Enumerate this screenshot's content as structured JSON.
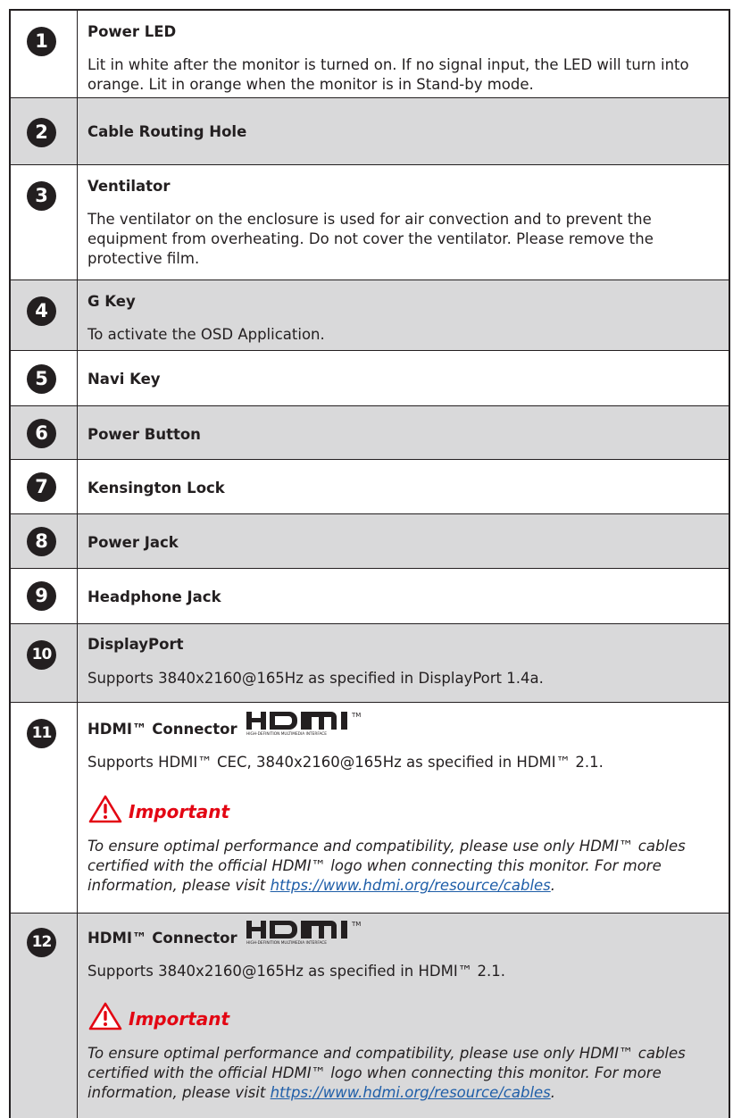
{
  "rows": [
    {
      "number": "1",
      "title": "Power LED",
      "description": "Lit in white after the monitor is turned on. If no signal input, the LED will turn into orange. Lit in orange when the monitor is in Stand-by mode."
    },
    {
      "number": "2",
      "title": "Cable Routing Hole"
    },
    {
      "number": "3",
      "title": "Ventilator",
      "description": "The ventilator on the enclosure is used for air convection and to prevent the equipment from overheating. Do not cover the ventilator. Please remove the protective film."
    },
    {
      "number": "4",
      "title": "G Key",
      "description": "To activate the OSD Application."
    },
    {
      "number": "5",
      "title": "Navi Key"
    },
    {
      "number": "6",
      "title": "Power Button"
    },
    {
      "number": "7",
      "title": "Kensington Lock"
    },
    {
      "number": "8",
      "title": "Power Jack"
    },
    {
      "number": "9",
      "title": "Headphone Jack"
    },
    {
      "number": "10",
      "title": "DisplayPort",
      "description": "Supports 3840x2160@165Hz as specified in DisplayPort 1.4a."
    },
    {
      "number": "11",
      "title": "HDMI™ Connector",
      "description": "Supports HDMI™ CEC, 3840x2160@165Hz as specified in HDMI™ 2.1."
    },
    {
      "number": "12",
      "title": "HDMI™ Connector",
      "description": "Supports 3840x2160@165Hz as specified in HDMI™ 2.1."
    }
  ],
  "hdmi_logo": {
    "wordmark": "HDMI",
    "tagline": "HIGH-DEFINITION MULTIMEDIA INTERFACE",
    "tm": "TM"
  },
  "important": {
    "title": "Important",
    "text": "To ensure optimal performance and compatibility, please use only HDMI™ cables certified with the official HDMI™ logo when connecting this monitor. For more information, please visit ",
    "link": "https://www.hdmi.org/resource/cables",
    "after_link": "."
  },
  "colors": {
    "shade": "#d9d9da",
    "border": "#231f20",
    "important_red": "#e30613",
    "link": "#1f5ea8"
  }
}
